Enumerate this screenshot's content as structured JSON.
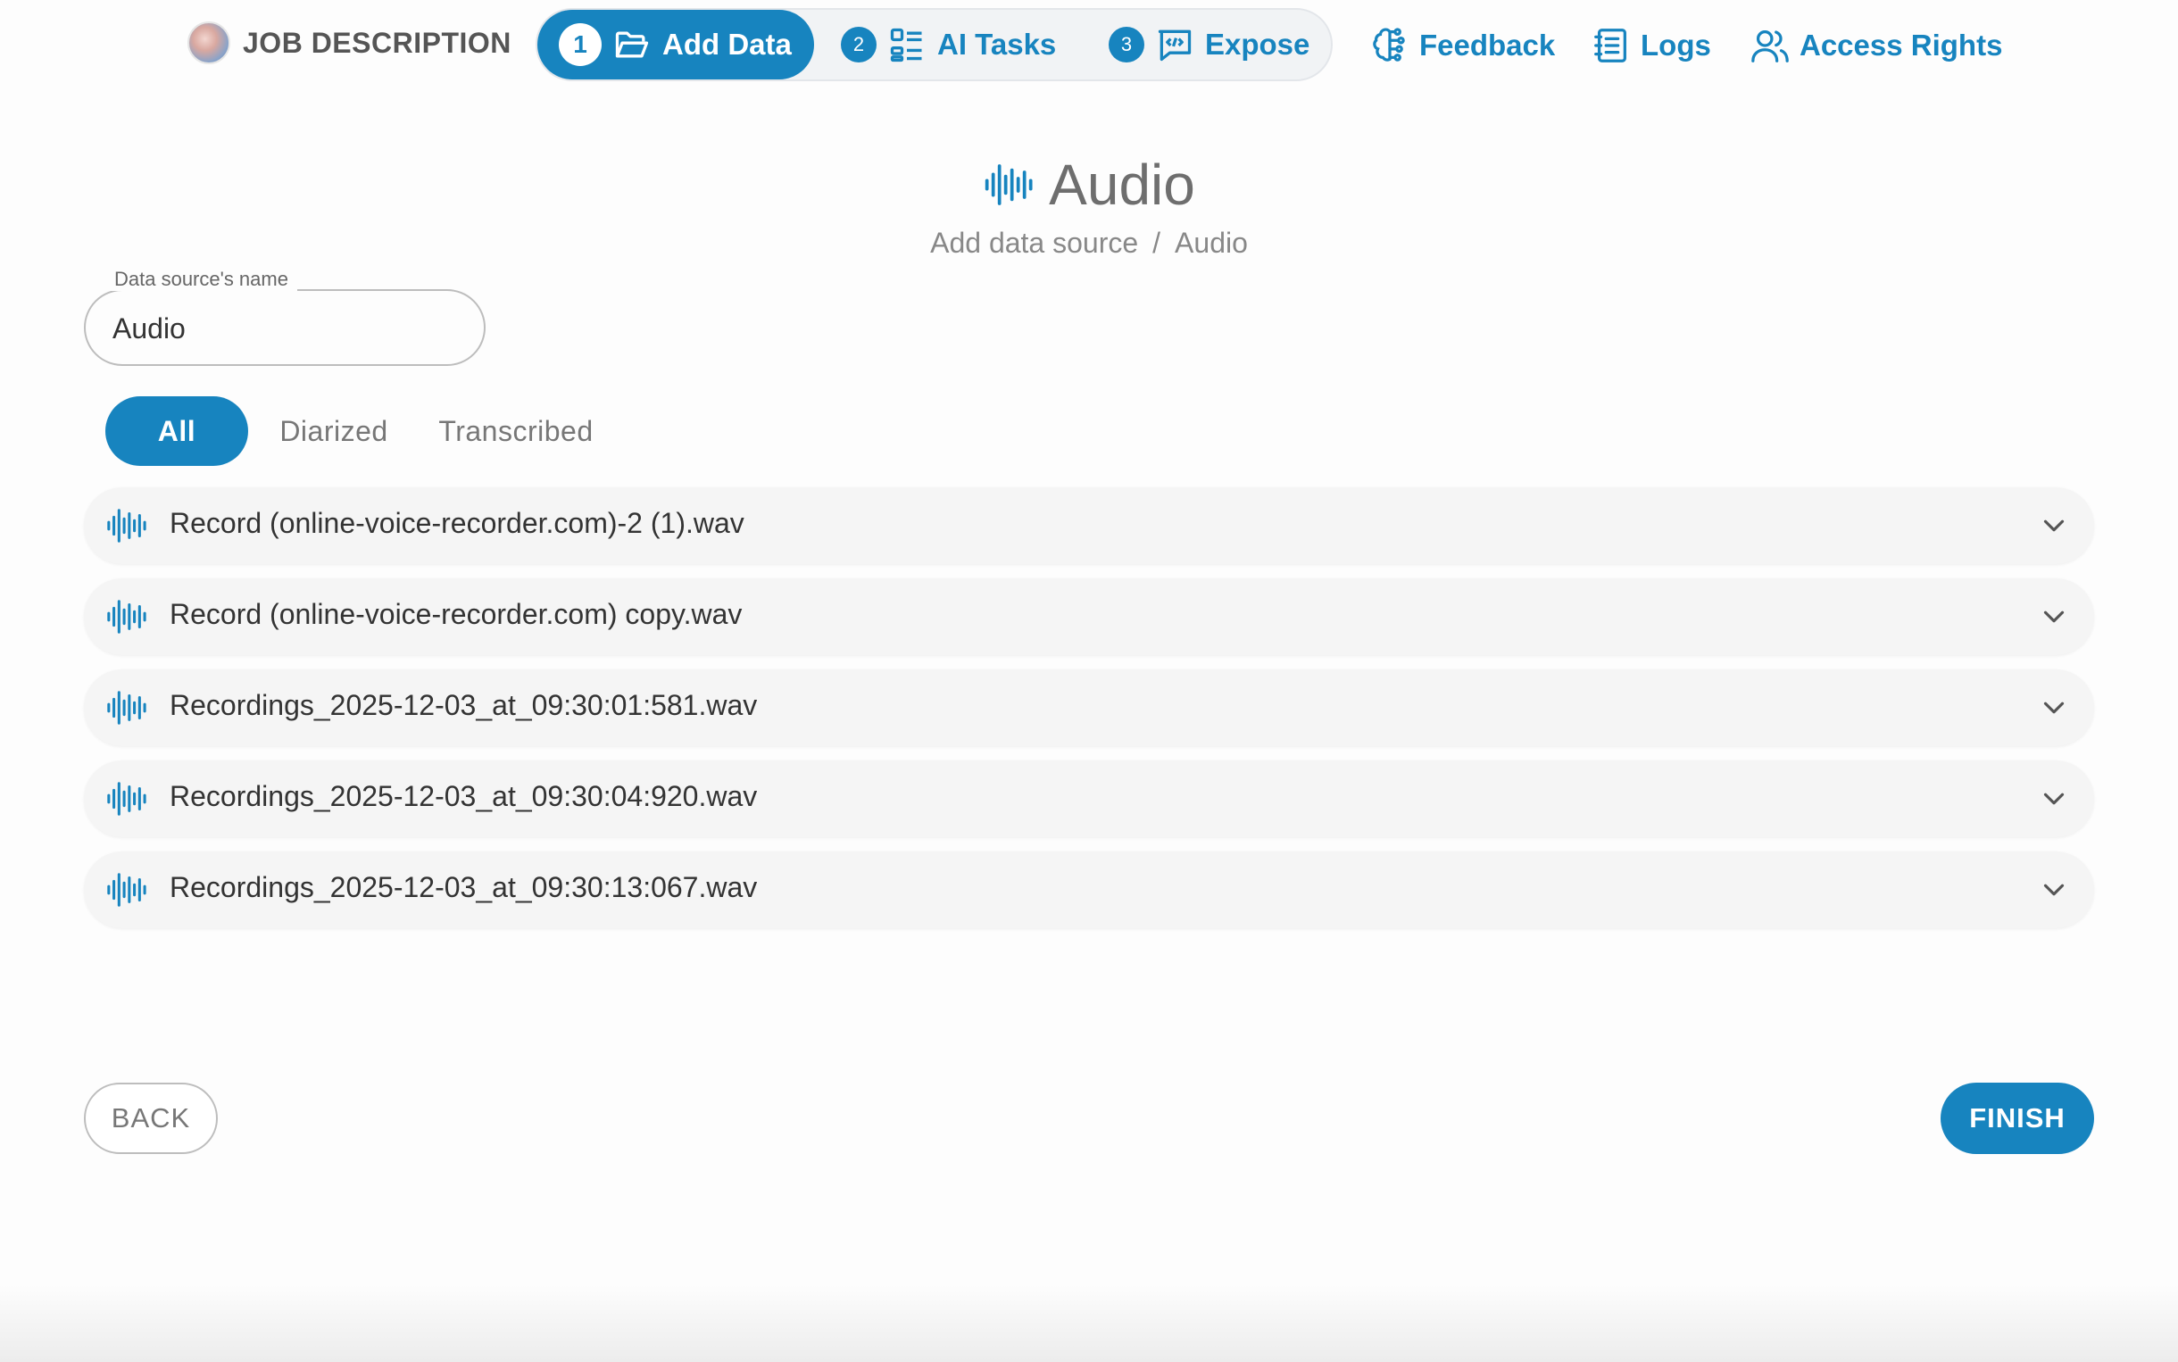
{
  "header": {
    "job_label": "JOB DESCRIPTION",
    "steps": [
      {
        "number": "1",
        "label": "Add Data",
        "icon": "folder-open-icon",
        "active": true
      },
      {
        "number": "2",
        "label": "AI Tasks",
        "icon": "list-tasks-icon",
        "active": false
      },
      {
        "number": "3",
        "label": "Expose",
        "icon": "code-chat-icon",
        "active": false
      }
    ],
    "links": [
      {
        "label": "Feedback",
        "icon": "brain-icon"
      },
      {
        "label": "Logs",
        "icon": "notebook-icon"
      },
      {
        "label": "Access Rights",
        "icon": "users-icon"
      }
    ]
  },
  "page": {
    "title": "Audio",
    "breadcrumb": [
      "Add data source",
      "Audio"
    ],
    "breadcrumb_separator": "/"
  },
  "form": {
    "name_label": "Data source's name",
    "name_value": "Audio"
  },
  "filters": [
    "All",
    "Diarized",
    "Transcribed"
  ],
  "active_filter": "All",
  "files": [
    "Record (online-voice-recorder.com)-2 (1).wav",
    "Record (online-voice-recorder.com) copy.wav",
    "Recordings_2025-12-03_at_09:30:01:581.wav",
    "Recordings_2025-12-03_at_09:30:04:920.wav",
    "Recordings_2025-12-03_at_09:30:13:067.wav"
  ],
  "buttons": {
    "back": "BACK",
    "finish": "FINISH"
  },
  "colors": {
    "accent": "#1784bf",
    "text": "#333333",
    "muted": "#888888"
  }
}
